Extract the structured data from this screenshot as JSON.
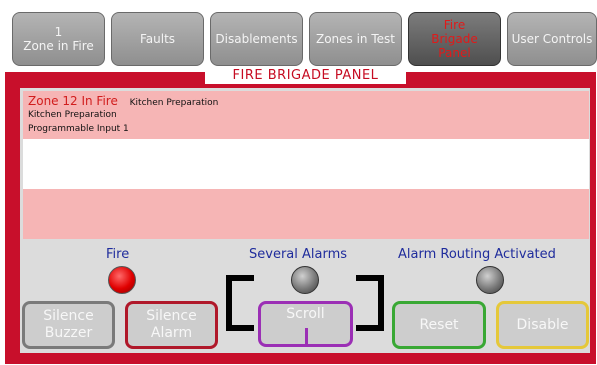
{
  "tabs": [
    {
      "label": "1\nZone in Fire",
      "active": false
    },
    {
      "label": "Faults",
      "active": false
    },
    {
      "label": "Disablements",
      "active": false
    },
    {
      "label": "Zones in Test",
      "active": false
    },
    {
      "label": "Fire\nBrigade\nPanel",
      "active": true
    },
    {
      "label": "User Controls",
      "active": false
    }
  ],
  "panel_title": "FIRE BRIGADE PANEL",
  "event": {
    "zone": "Zone 12 In Fire",
    "description": "Kitchen Preparation",
    "line2": "Kitchen Preparation",
    "line3": "Programmable Input 1"
  },
  "indicators": [
    {
      "label": "Fire",
      "state": "red"
    },
    {
      "label": "Several Alarms",
      "state": "off"
    },
    {
      "label": "Alarm Routing Activated",
      "state": "off"
    }
  ],
  "buttons": {
    "silence_buzzer": "Silence\nBuzzer",
    "silence_alarm": "Silence\nAlarm",
    "scroll": "Scroll",
    "reset": "Reset",
    "disable": "Disable"
  },
  "colors": {
    "frame_red": "#c80f2b",
    "title_red": "#c60c22",
    "label_blue": "#1f2c9c",
    "silence_buzzer_border": "#7a7a7a",
    "silence_alarm_border": "#b0182a",
    "scroll_border": "#9b2fb5",
    "reset_border": "#39a834",
    "disable_border": "#e5c83a"
  }
}
